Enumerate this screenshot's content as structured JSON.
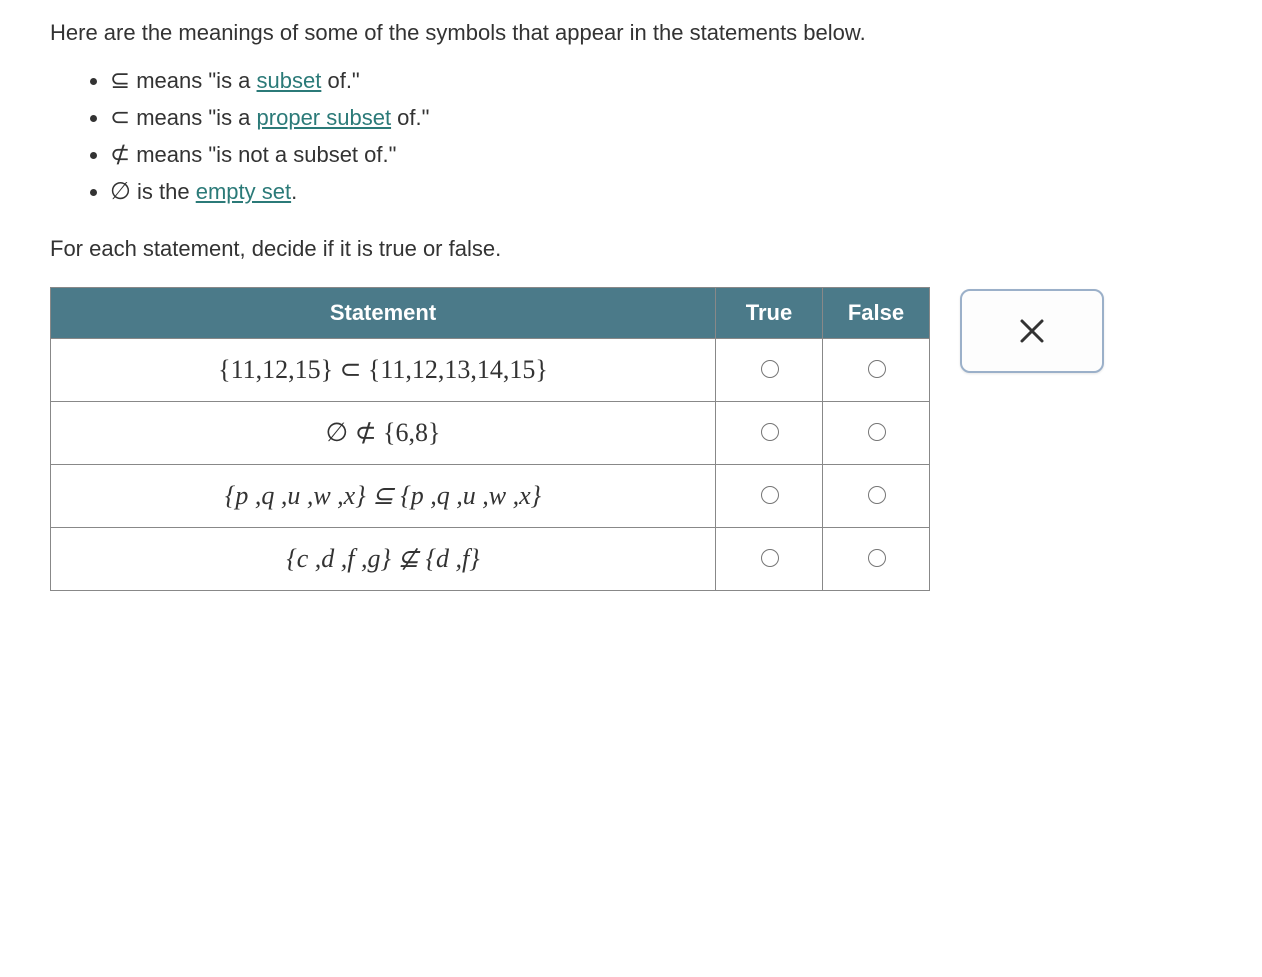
{
  "intro": "Here are the meanings of some of the symbols that appear in the statements below.",
  "bullets": [
    {
      "sym": "⊆",
      "pre": " means \"is a ",
      "link": "subset",
      "post": " of.\""
    },
    {
      "sym": "⊂",
      "pre": " means \"is a ",
      "link": "proper subset",
      "post": " of.\""
    },
    {
      "sym": "⊄",
      "pre": " means \"is not a subset of.\"",
      "link": "",
      "post": ""
    },
    {
      "sym": "∅",
      "pre": " is the ",
      "link": "empty set",
      "post": "."
    }
  ],
  "instruct": "For each statement, decide if it is true or false.",
  "headers": {
    "stmt": "Statement",
    "t": "True",
    "f": "False"
  },
  "rows": [
    "{11,12,15} ⊂ {11,12,13,14,15}",
    "∅ ⊄ {6,8}",
    "{p ,q ,u ,w ,x} ⊆ {p ,q ,u ,w ,x}",
    "{c ,d ,f ,g} ⊈ {d ,f}"
  ],
  "row1_true_checked": false
}
